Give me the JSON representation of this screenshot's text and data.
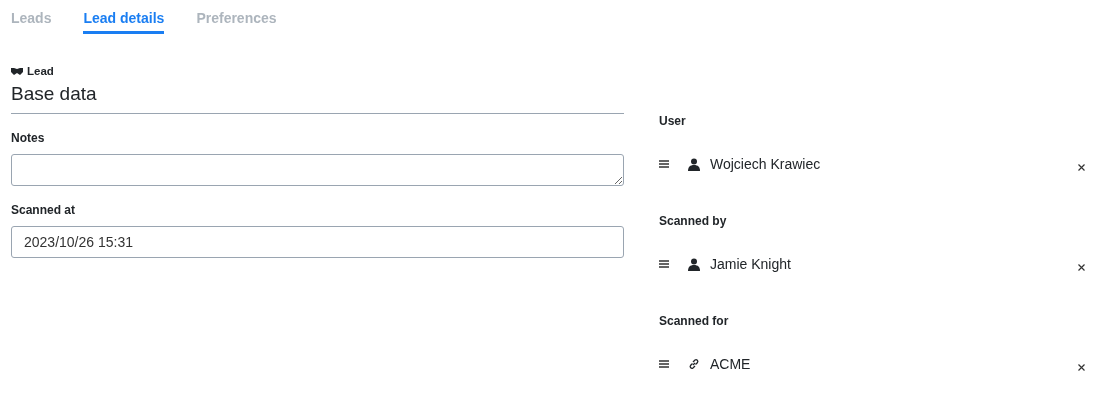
{
  "tabs": [
    {
      "label": "Leads",
      "selected": false
    },
    {
      "label": "Lead details",
      "selected": true
    },
    {
      "label": "Preferences",
      "selected": false
    }
  ],
  "section": {
    "label": "Lead",
    "title": "Base data"
  },
  "fields": [
    {
      "label": "Notes",
      "kind": "textarea"
    },
    {
      "label": "Scanned at",
      "kind": "text",
      "value": "2023/10/26 15:31"
    }
  ],
  "relations": [
    {
      "label": "User",
      "kind": "person",
      "value": "Wojciech Krawiec"
    },
    {
      "label": "Scanned by",
      "kind": "person",
      "value": "Jamie Knight"
    },
    {
      "label": "Scanned for",
      "kind": "link",
      "value": "ACME"
    }
  ]
}
